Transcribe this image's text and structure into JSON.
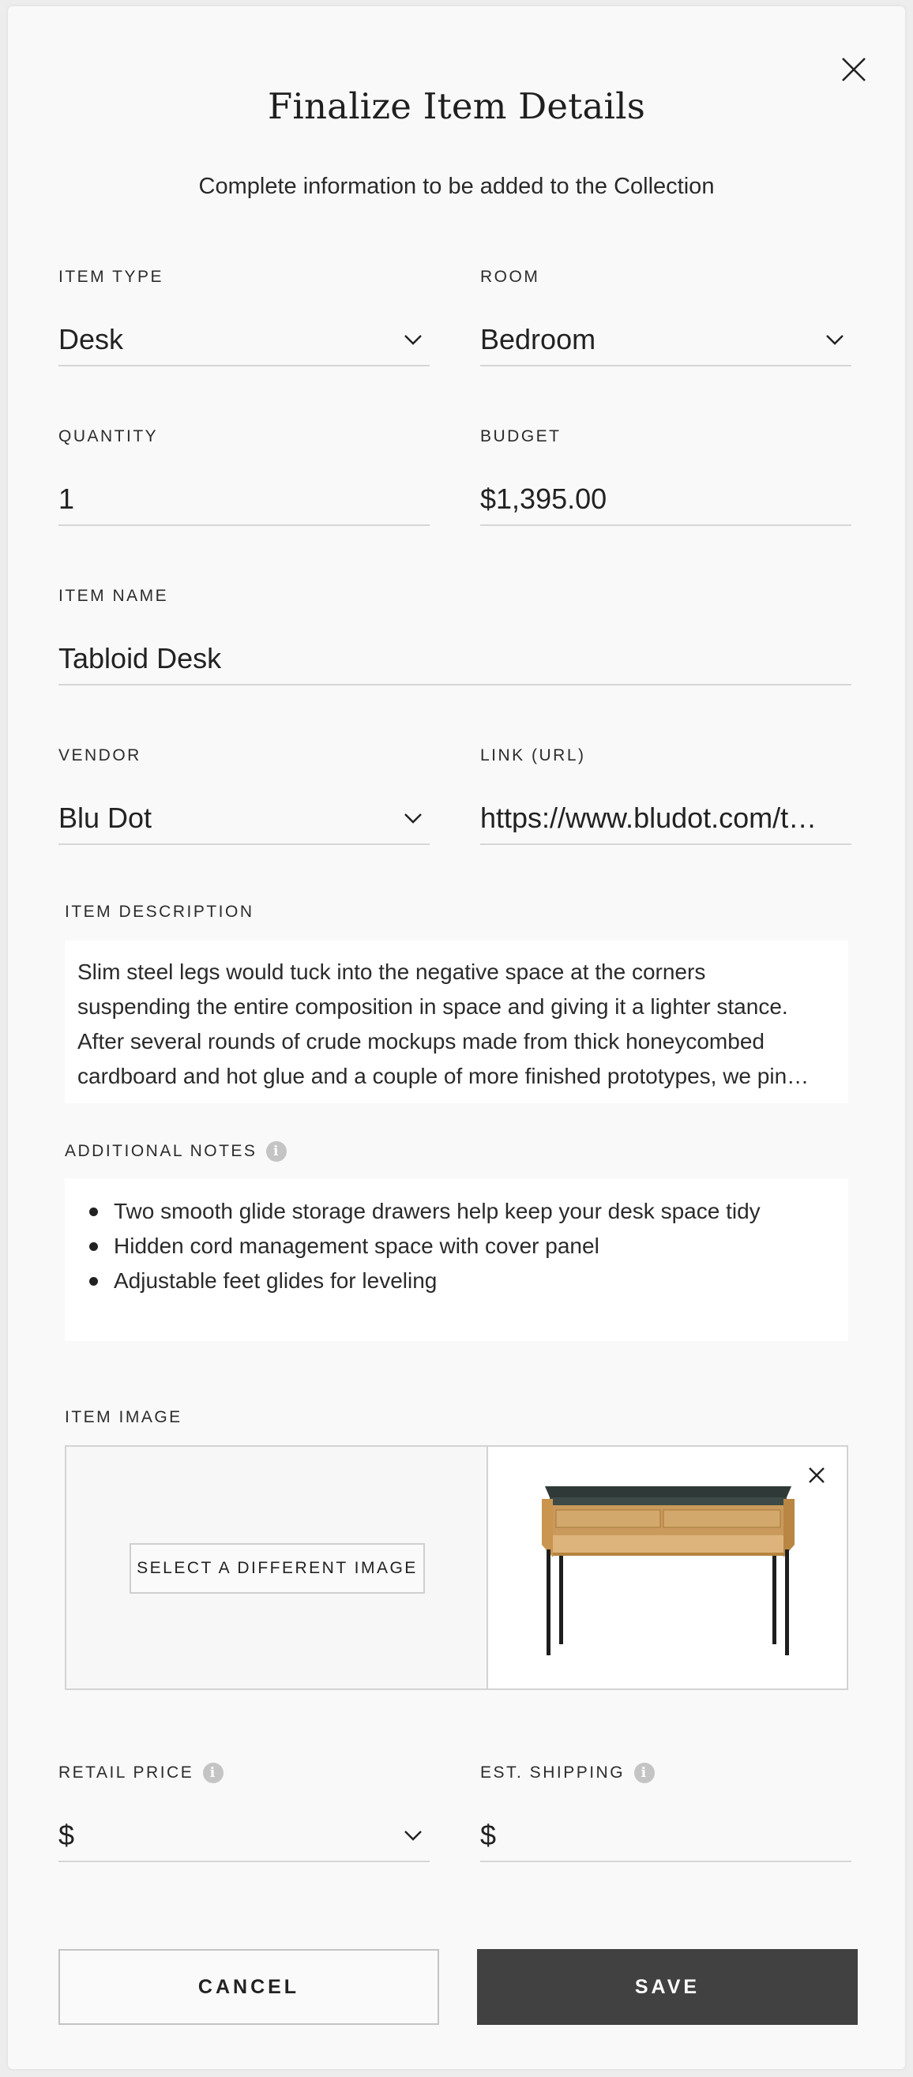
{
  "modal": {
    "title": "Finalize Item Details",
    "subtitle": "Complete information to be added to the Collection"
  },
  "fields": {
    "item_type": {
      "label": "ITEM TYPE",
      "value": "Desk"
    },
    "room": {
      "label": "ROOM",
      "value": "Bedroom"
    },
    "quantity": {
      "label": "QUANTITY",
      "value": "1"
    },
    "budget": {
      "label": "BUDGET",
      "value": "$1,395.00"
    },
    "item_name": {
      "label": "ITEM NAME",
      "value": "Tabloid Desk"
    },
    "vendor": {
      "label": "VENDOR",
      "value": "Blu Dot"
    },
    "link": {
      "label": "LINK (URL)",
      "value": "https://www.bludot.com/t…"
    },
    "retail_price": {
      "label": "RETAIL PRICE",
      "value": "$"
    },
    "est_shipping": {
      "label": "EST. SHIPPING",
      "value": "$"
    }
  },
  "description": {
    "label": "ITEM DESCRIPTION",
    "lines": [
      "Slim steel legs would tuck into the negative space at the corners",
      "suspending the entire composition in space and giving it a lighter stance.",
      "After several rounds of crude mockups made from thick honeycombed",
      "cardboard and hot glue and a couple of more finished prototypes, we pin…"
    ]
  },
  "notes": {
    "label": "ADDITIONAL NOTES",
    "items": [
      "Two smooth glide storage drawers help keep your desk space tidy",
      "Hidden cord management space with cover panel",
      "Adjustable feet glides for leveling"
    ]
  },
  "image": {
    "label": "ITEM IMAGE",
    "select_button": "SELECT A DIFFERENT IMAGE"
  },
  "actions": {
    "cancel": "CANCEL",
    "save": "SAVE"
  },
  "icons": {
    "close": "close-icon",
    "dropdown": "chevron-down-icon",
    "info": "info-icon",
    "remove_image": "remove-image-icon"
  },
  "colors": {
    "save_button_bg": "#414141",
    "page_bg": "#f9f9f9",
    "info_icon": "#c4c4c4"
  }
}
